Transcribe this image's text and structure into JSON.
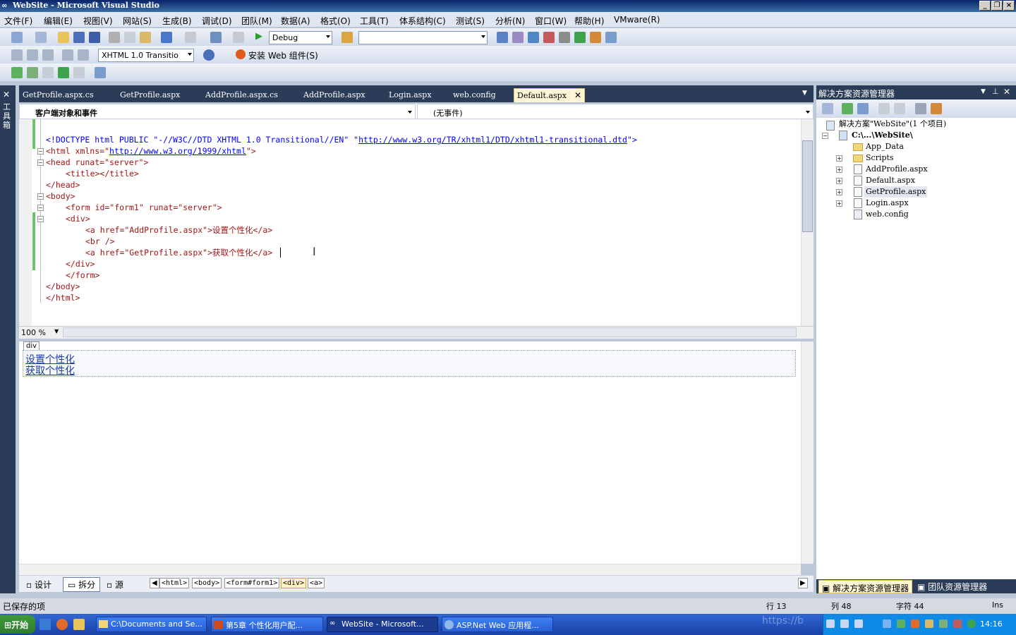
{
  "window": {
    "title": "WebSite - Microsoft Visual Studio"
  },
  "menu": [
    "文件(F)",
    "编辑(E)",
    "视图(V)",
    "网站(S)",
    "生成(B)",
    "调试(D)",
    "团队(M)",
    "数据(A)",
    "格式(O)",
    "工具(T)",
    "体系结构(C)",
    "测试(S)",
    "分析(N)",
    "窗口(W)",
    "帮助(H)",
    "VMware(R)"
  ],
  "toolbar": {
    "config": "Debug",
    "platform": "",
    "doctype": "XHTML 1.0 Transitio",
    "install_web": "安装 Web 组件(S)"
  },
  "toolbox": {
    "label": "工具箱"
  },
  "tabs": [
    "GetProfile.aspx.cs",
    "GetProfile.aspx",
    "AddProfile.aspx.cs",
    "AddProfile.aspx",
    "Login.aspx",
    "web.config",
    "Default.aspx"
  ],
  "navbar": {
    "left": "客户端对象和事件",
    "right": "(无事件)"
  },
  "code": {
    "doctype_pre": "<!DOCTYPE html PUBLIC \"-//W3C//DTD XHTML 1.0 Transitional//EN\" \"",
    "doctype_url": "http://www.w3.org/TR/xhtml1/DTD/xhtml1-transitional.dtd",
    "doctype_post": "\">",
    "html_open_pre": "<html xmlns=\"",
    "html_url": "http://www.w3.org/1999/xhtml",
    "html_open_post": "\">",
    "head_open": "<head runat=\"server\">",
    "title": "<title></title>",
    "head_close": "</head>",
    "body_open": "<body>",
    "form_open": "<form id=\"form1\" runat=\"server\">",
    "div_open": "<div>",
    "a1": "<a href=\"AddProfile.aspx\">设置个性化</a>",
    "br": "<br />",
    "a2": "<a href=\"GetProfile.aspx\">获取个性化</a>",
    "div_close": "</div>",
    "form_close": "</form>",
    "body_close": "</body>",
    "html_close": "</html>"
  },
  "zoom": "100 %",
  "design": {
    "tag": "div",
    "link1": "设置个性化",
    "link2": "获取个性化"
  },
  "views": {
    "design": "设计",
    "split": "拆分",
    "source": "源"
  },
  "breadcrumb": [
    "<html>",
    "<body>",
    "<form#form1>",
    "<div>",
    "<a>"
  ],
  "solution_explorer": {
    "title": "解决方案资源管理器",
    "solution": "解决方案\"WebSite\"(1 个项目)",
    "project": "C:\\...\\WebSite\\",
    "items": [
      "App_Data",
      "Scripts",
      "AddProfile.aspx",
      "Default.aspx",
      "GetProfile.aspx",
      "Login.aspx",
      "web.config"
    ],
    "tab1": "解决方案资源管理器",
    "tab2": "团队资源管理器"
  },
  "status": {
    "message": "已保存的项",
    "line": "行 13",
    "col": "列 48",
    "ch": "字符 44",
    "mode": "Ins"
  },
  "taskbar": {
    "start": "开始",
    "tasks": [
      "C:\\Documents and Se...",
      "第5章 个性化用户配...",
      "WebSite - Microsoft...",
      "ASP.Net Web 应用程..."
    ],
    "watermark": "https://b",
    "clock": "14:16"
  }
}
